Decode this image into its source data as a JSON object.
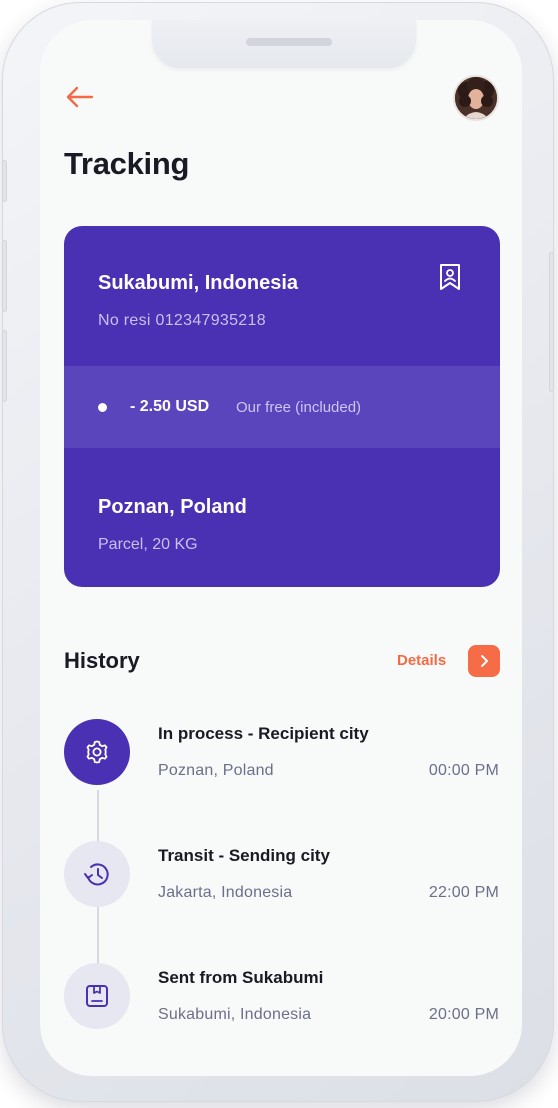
{
  "header": {
    "back_icon": "arrow-left-icon",
    "avatar_icon": "user-avatar",
    "title": "Tracking"
  },
  "shipment": {
    "origin": "Sukabumi, Indonesia",
    "receipt": "No resi 012347935218",
    "bookmark_icon": "bookmark-icon",
    "fee_amount": "- 2.50 USD",
    "fee_note": "Our free (included)",
    "destination": "Poznan, Poland",
    "parcel": "Parcel, 20 KG"
  },
  "history": {
    "title": "History",
    "details_label": "Details",
    "details_icon": "chevron-right-icon",
    "items": [
      {
        "icon": "gear-icon",
        "title": "In process - Recipient city",
        "place": "Poznan, Poland",
        "time": "00:00 PM",
        "active": true
      },
      {
        "icon": "history-clock-icon",
        "title": "Transit - Sending city",
        "place": "Jakarta, Indonesia",
        "time": "22:00 PM",
        "active": false
      },
      {
        "icon": "box-icon",
        "title": "Sent from Sukabumi",
        "place": "Sukabumi, Indonesia",
        "time": "20:00 PM",
        "active": false
      }
    ]
  },
  "colors": {
    "primary": "#4a30b3",
    "primary_band": "#5a45bd",
    "accent": "#f56c46",
    "text_dark": "#1a1a24",
    "text_muted": "#6c6f8a",
    "screen_bg": "#f8f9f9"
  }
}
